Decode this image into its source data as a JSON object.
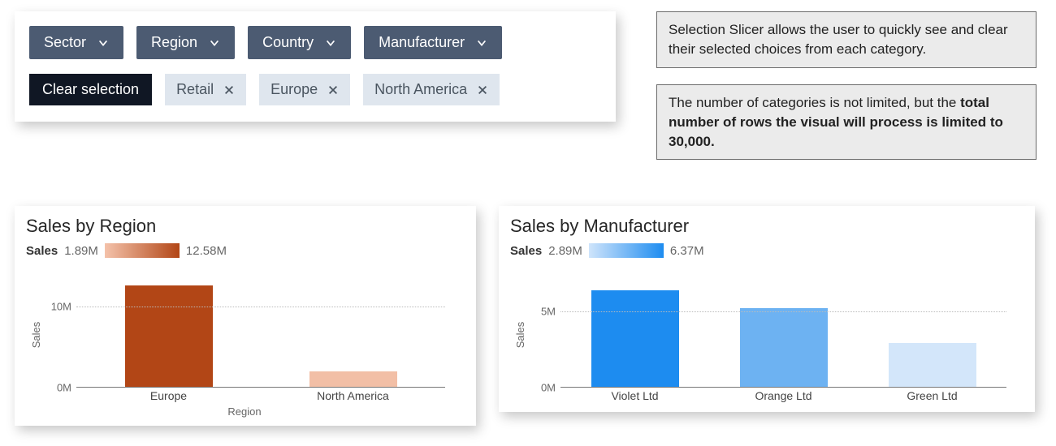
{
  "slicer": {
    "dropdowns": [
      "Sector",
      "Region",
      "Country",
      "Manufacturer"
    ],
    "clear_label": "Clear selection",
    "chips": [
      "Retail",
      "Europe",
      "North America"
    ]
  },
  "info": {
    "box1": "Selection Slicer allows the user to quickly see and clear their selected choices from each category.",
    "box2_plain": "The number of categories is not limited, but the ",
    "box2_bold": "total number of rows the visual will process is limited to 30,000."
  },
  "chart_left": {
    "title": "Sales by Region",
    "legend_label": "Sales",
    "legend_min": "1.89M",
    "legend_max": "12.58M",
    "ylabel": "Sales",
    "xlabel": "Region",
    "yticks": [
      "10M",
      "0M"
    ]
  },
  "chart_right": {
    "title": "Sales by Manufacturer",
    "legend_label": "Sales",
    "legend_min": "2.89M",
    "legend_max": "6.37M",
    "ylabel": "Sales",
    "yticks": [
      "5M",
      "0M"
    ]
  },
  "chart_data": [
    {
      "type": "bar",
      "title": "Sales by Region",
      "xlabel": "Region",
      "ylabel": "Sales",
      "ylim": [
        0,
        15
      ],
      "unit": "M",
      "categories": [
        "Europe",
        "North America"
      ],
      "values": [
        12.58,
        1.89
      ],
      "colors": [
        "#b24616",
        "#f2bfa6"
      ]
    },
    {
      "type": "bar",
      "title": "Sales by Manufacturer",
      "xlabel": "",
      "ylabel": "Sales",
      "ylim": [
        0,
        8
      ],
      "unit": "M",
      "categories": [
        "Violet Ltd",
        "Orange Ltd",
        "Green Ltd"
      ],
      "values": [
        6.37,
        5.2,
        2.89
      ],
      "colors": [
        "#1d8cf0",
        "#6db2f2",
        "#d3e6fa"
      ]
    }
  ]
}
